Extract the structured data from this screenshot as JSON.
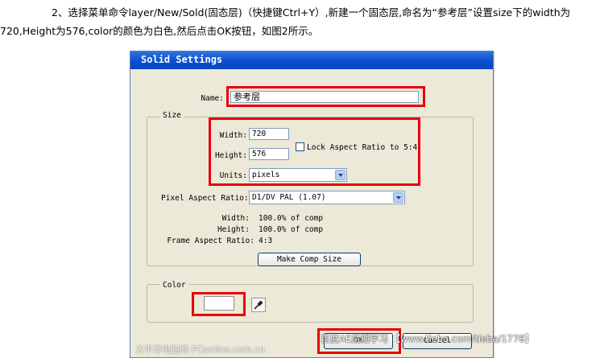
{
  "instruction": {
    "line1": "2、选择菜单命令layer/New/Sold(固态层)（快捷键Ctrl+Y）,新建一个固态层,命名为“参考层”设置size下的width为",
    "line2": "720,Height为576,color的颜色为白色,然后点击OK按钮，如图2所示。"
  },
  "dialog": {
    "title": "Solid Settings",
    "name_label": "Name:",
    "name_value": "参考层",
    "size_group": "Size",
    "width_label": "Width:",
    "width_value": "720",
    "height_label": "Height:",
    "height_value": "576",
    "lock_label": "Lock Aspect Ratio to 5:4",
    "units_label": "Units:",
    "units_value": "pixels",
    "par_label": "Pixel Aspect Ratio:",
    "par_value": "D1/DV PAL (1.07)",
    "info_width_label": "Width:",
    "info_width_value": "100.0% of comp",
    "info_height_label": "Height:",
    "info_height_value": "100.0% of comp",
    "info_frame_label": "Frame Aspect Ratio:",
    "info_frame_value": "4:3",
    "make_comp_size": "Make Comp Size",
    "color_group": "Color",
    "color_value": "#ffffff",
    "ok_label": "OK",
    "cancel_label": "Cancel"
  },
  "watermark": {
    "left": "太平洋电脑网 PConline.com.cn",
    "right": "百度AE后期学习 【www.tieba.com/tieba/1778】"
  }
}
